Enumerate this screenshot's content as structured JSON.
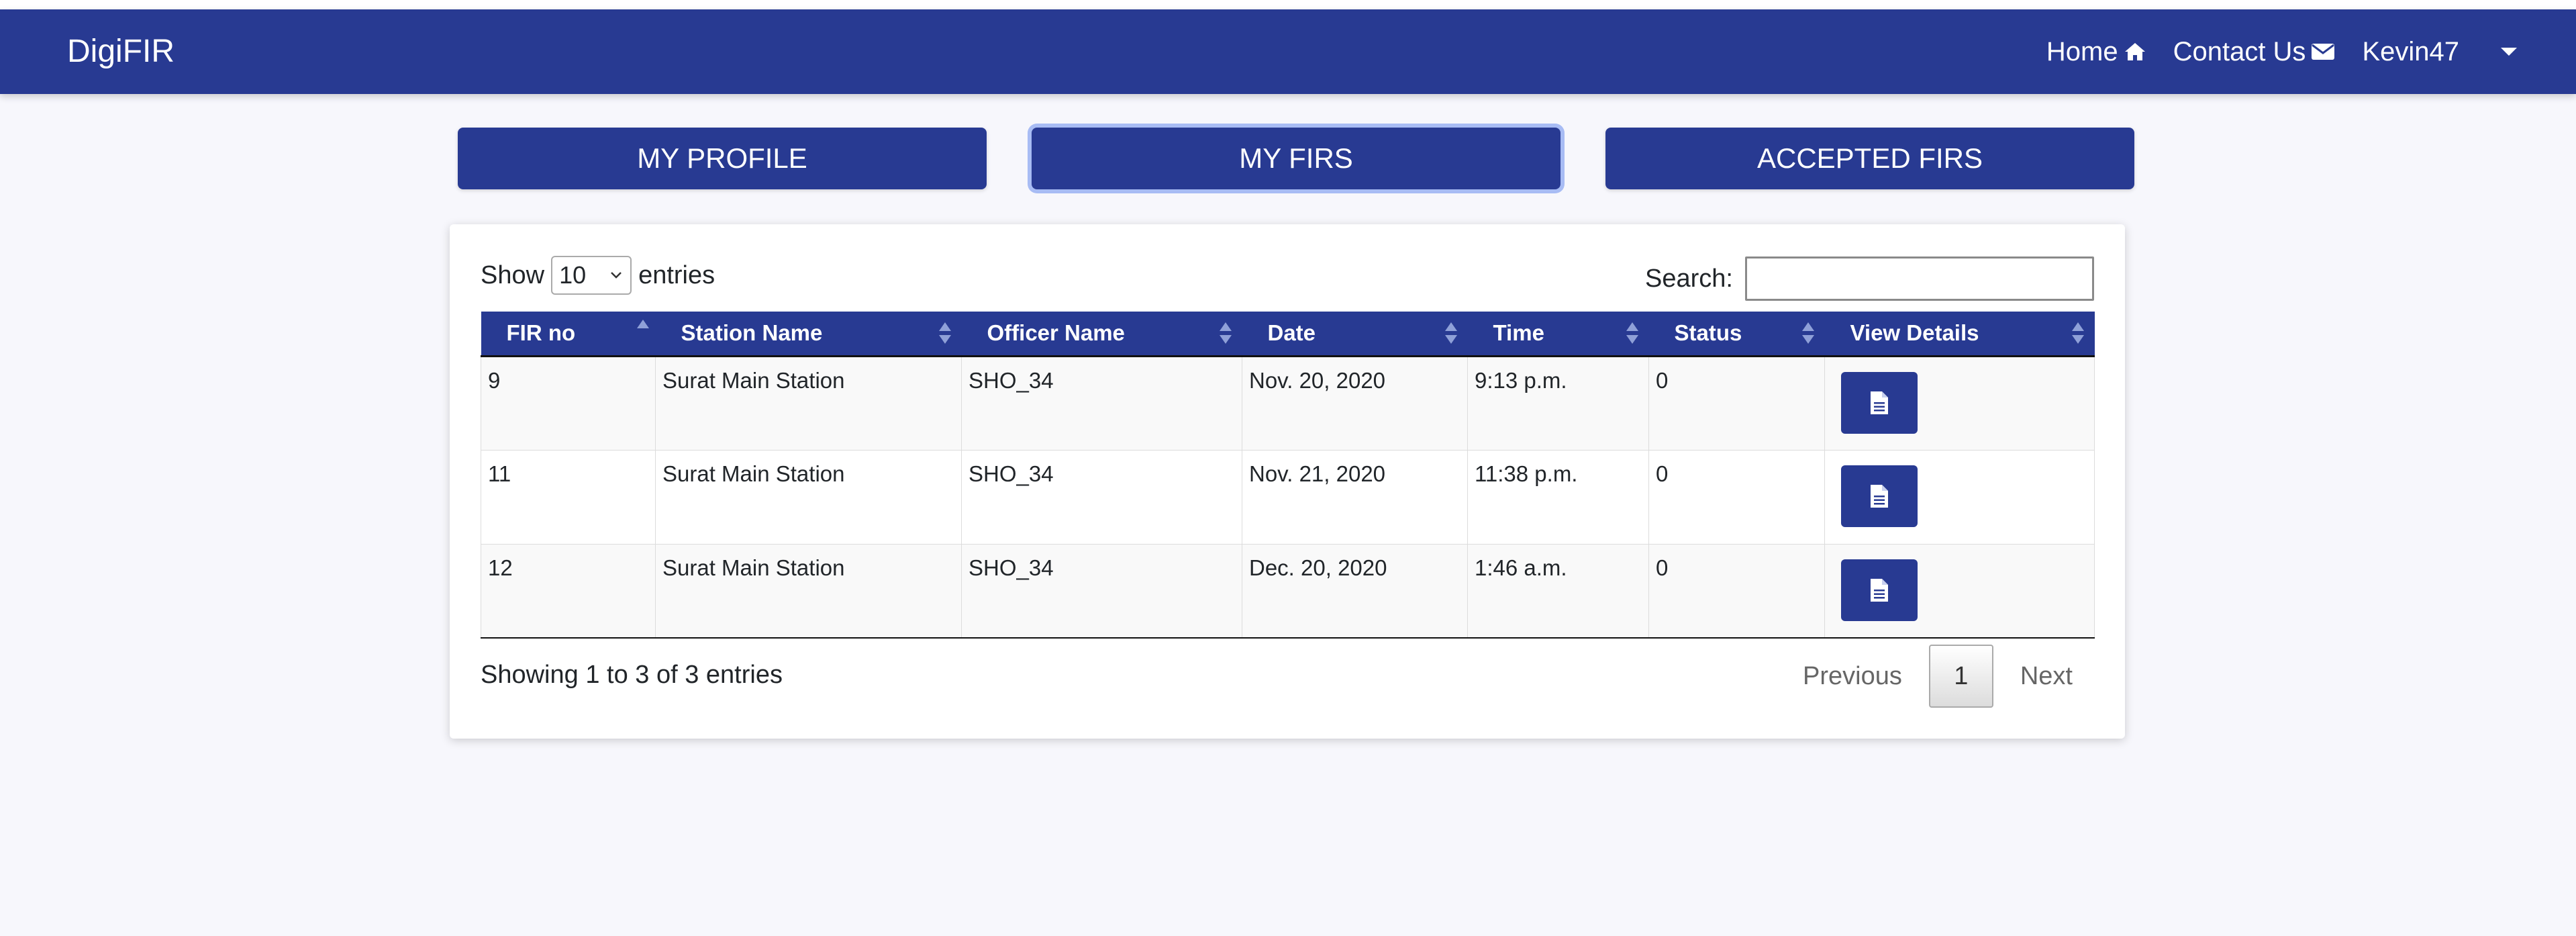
{
  "navbar": {
    "brand": "DigiFIR",
    "home_label": "Home",
    "contact_label": "Contact Us",
    "user_label": "Kevin47"
  },
  "tabs": [
    {
      "label": "MY PROFILE"
    },
    {
      "label": "MY FIRS",
      "active": true
    },
    {
      "label": "ACCEPTED FIRS"
    }
  ],
  "table_controls": {
    "show_label": "Show",
    "entries_label": "entries",
    "page_length": "10",
    "search_label": "Search:",
    "search_value": ""
  },
  "table": {
    "columns": [
      "FIR no",
      "Station Name",
      "Officer Name",
      "Date",
      "Time",
      "Status",
      "View Details"
    ],
    "rows": [
      {
        "fir_no": "9",
        "station": "Surat Main Station",
        "officer": "SHO_34",
        "date": "Nov. 20, 2020",
        "time": "9:13 p.m.",
        "status": "0"
      },
      {
        "fir_no": "11",
        "station": "Surat Main Station",
        "officer": "SHO_34",
        "date": "Nov. 21, 2020",
        "time": "11:38 p.m.",
        "status": "0"
      },
      {
        "fir_no": "12",
        "station": "Surat Main Station",
        "officer": "SHO_34",
        "date": "Dec. 20, 2020",
        "time": "1:46 a.m.",
        "status": "0"
      }
    ]
  },
  "footer": {
    "info": "Showing 1 to 3 of 3 entries",
    "previous": "Previous",
    "current_page": "1",
    "next": "Next"
  },
  "colors": {
    "primary": "#283a92",
    "background": "#f7f7fc"
  }
}
